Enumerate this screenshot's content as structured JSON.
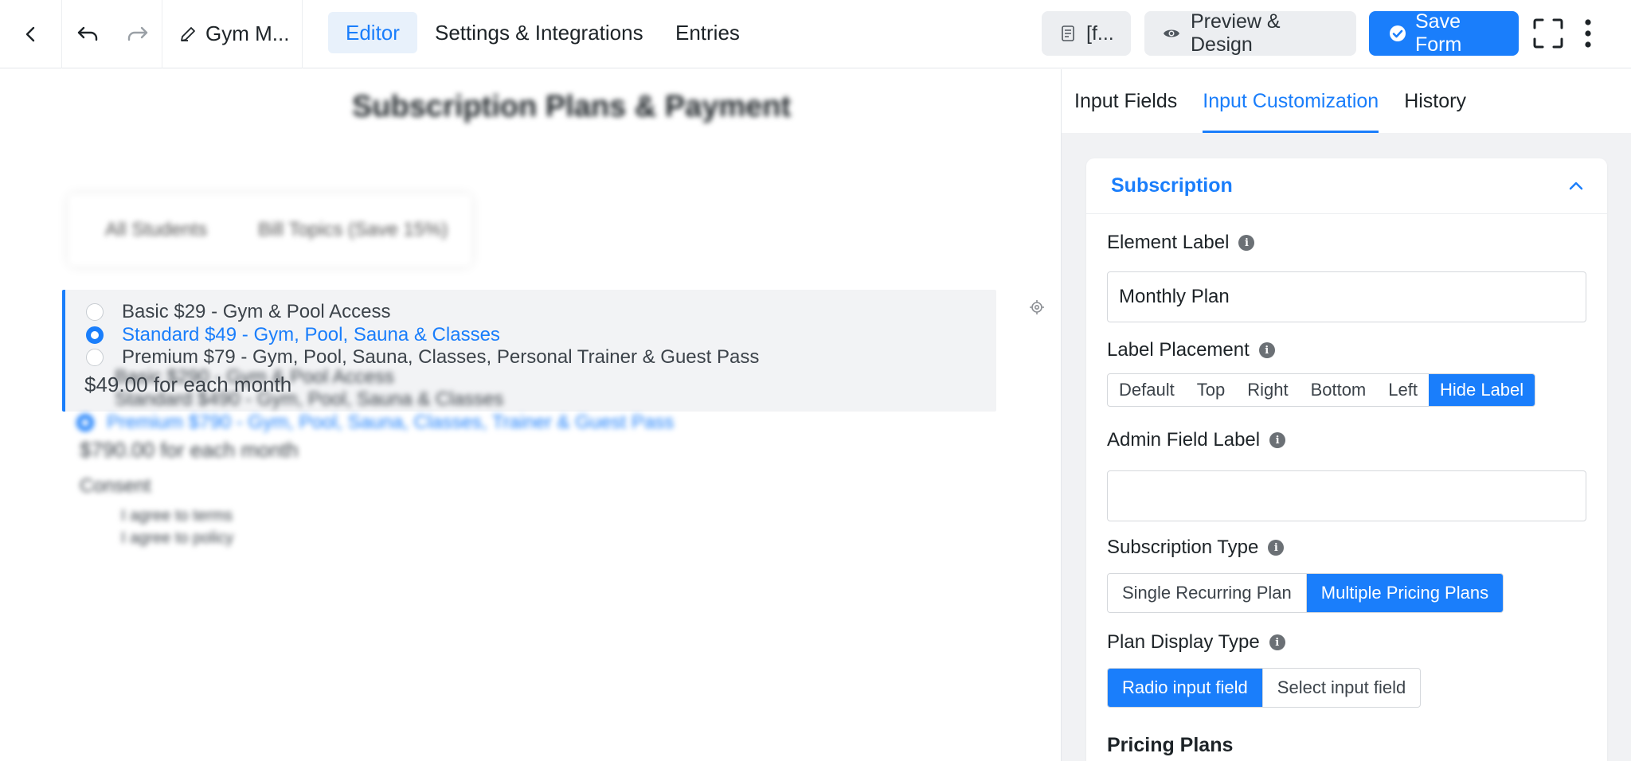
{
  "topbar": {
    "form_title": "Gym M...",
    "nav": {
      "editor": "Editor",
      "settings": "Settings & Integrations",
      "entries": "Entries"
    },
    "shortcode_label": "[f...",
    "preview_label": "Preview & Design",
    "save_label": "Save Form"
  },
  "canvas": {
    "form_title": "Subscription Plans & Payment",
    "blurred_tabs": [
      "All Students",
      "Bill Topics (Save 15%)"
    ],
    "plan_field": {
      "options": [
        {
          "label": "Basic $29 - Gym & Pool Access",
          "selected": false
        },
        {
          "label": "Standard $49 - Gym, Pool, Sauna & Classes",
          "selected": true
        },
        {
          "label": "Premium $79 - Gym, Pool, Sauna, Classes, Personal Trainer & Guest Pass",
          "selected": false
        }
      ],
      "price_note": "$49.00 for each month"
    },
    "blurred_field": {
      "options": [
        "Basic $290 - Gym & Pool Access",
        "Standard $490 - Gym, Pool, Sauna & Classes",
        "Premium $790 - Gym, Pool, Sauna, Classes, Trainer & Guest Pass"
      ],
      "price_note": "$790.00 for each month"
    },
    "blurred_checkbox": {
      "label": "Consent",
      "options": [
        "I agree to terms",
        "I agree to policy"
      ]
    }
  },
  "panel": {
    "tabs": [
      "Input Fields",
      "Input Customization",
      "History"
    ],
    "active_tab": "Input Customization",
    "section_title": "Subscription",
    "element_label": {
      "label": "Element Label",
      "value": "Monthly Plan"
    },
    "label_placement": {
      "label": "Label Placement",
      "options": [
        "Default",
        "Top",
        "Right",
        "Bottom",
        "Left",
        "Hide Label"
      ],
      "selected": "Hide Label"
    },
    "admin_field_label": {
      "label": "Admin Field Label",
      "value": ""
    },
    "subscription_type": {
      "label": "Subscription Type",
      "options": [
        "Single Recurring Plan",
        "Multiple Pricing Plans"
      ],
      "selected": "Multiple Pricing Plans"
    },
    "plan_display_type": {
      "label": "Plan Display Type",
      "options": [
        "Radio input field",
        "Select input field"
      ],
      "selected": "Radio input field"
    },
    "pricing_plans_heading": "Pricing Plans"
  },
  "colors": {
    "accent": "#1a7efb",
    "panel_bg": "#f1f2f4",
    "active_field_bg": "#f2f3f5"
  }
}
